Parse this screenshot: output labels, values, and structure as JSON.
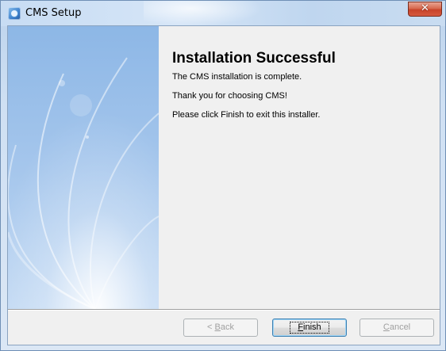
{
  "window": {
    "title": "CMS Setup",
    "close_glyph": "✕",
    "app_icon": "setup-installer-icon"
  },
  "content": {
    "heading": "Installation Successful",
    "lines": [
      "The CMS  installation is complete.",
      "Thank you for choosing CMS!",
      "Please click Finish to exit this installer."
    ]
  },
  "buttons": {
    "back": {
      "prefix": "< ",
      "mnemonic": "B",
      "rest": "ack",
      "enabled": false
    },
    "finish": {
      "prefix": "",
      "mnemonic": "F",
      "rest": "inish",
      "enabled": true,
      "default": true
    },
    "cancel": {
      "prefix": "",
      "mnemonic": "C",
      "rest": "ancel",
      "enabled": false
    }
  },
  "colors": {
    "side_panel": "#8db7e6",
    "close_button": "#c8432a",
    "default_button_border": "#3c7fb1"
  }
}
